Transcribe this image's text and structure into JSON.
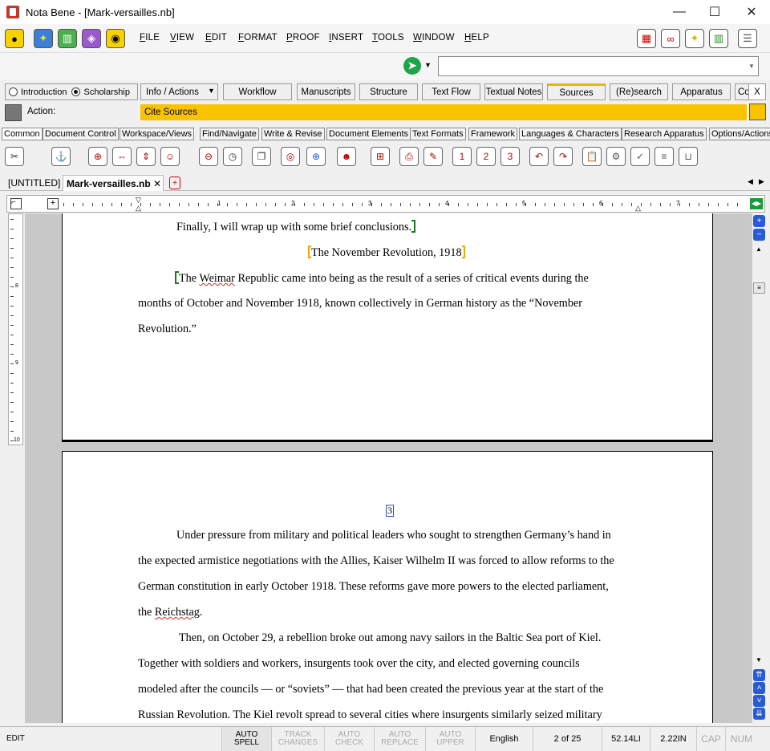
{
  "window": {
    "title": "Nota Bene - [Mark-versailles.nb]",
    "minimize": "—",
    "maximize": "☐",
    "close": "✕"
  },
  "menu": [
    "FILE",
    "VIEW",
    "EDIT",
    "FORMAT",
    "PROOF",
    "INSERT",
    "TOOLS",
    "WINDOW",
    "HELP"
  ],
  "workspace": {
    "radio_introduction": "Introduction",
    "radio_scholarship": "Scholarship",
    "info_actions": "Info / Actions",
    "tabs": [
      "Workflow",
      "Manuscripts",
      "Structure",
      "Text Flow",
      "Textual Notes",
      "Sources",
      "(Re)search",
      "Apparatus",
      "Co"
    ],
    "active_tab": "Sources",
    "close_label": "X"
  },
  "action": {
    "label": "Action:",
    "value": "Cite Sources"
  },
  "toolbar_groups": [
    "Common",
    "Document Control",
    "Workspace/Views",
    "Find/Navigate",
    "Write & Revise",
    "Document Elements",
    "Text Formats",
    "Framework",
    "Languages & Characters",
    "Research Apparatus",
    "Options/Actions"
  ],
  "doc_tabs": {
    "untitled": "[UNTITLED]",
    "current": "Mark-versailles.nb",
    "close": "✕"
  },
  "ruler": {
    "numbers": [
      "1",
      "2",
      "3",
      "4",
      "5",
      "6",
      "7"
    ]
  },
  "vruler": {
    "numbers": [
      "8",
      "9",
      "10"
    ]
  },
  "document": {
    "page1": {
      "l1": "Finally, I will wrap up with some brief conclusions.",
      "heading": "The November Revolution, 1918",
      "p_a1": "The ",
      "p_a2": "Weimar",
      "p_a3": " Republic came into being as the result of a series of critical events during the",
      "p_b": "months of October and November 1918, known collectively in German history as the “November",
      "p_c": "Revolution.”"
    },
    "page2": {
      "page_number": "3",
      "l1": "Under pressure from military and political leaders who sought to strengthen Germany’s hand in",
      "l2": "the expected armistice negotiations with the Allies, Kaiser Wilhelm II was forced to allow reforms to the",
      "l3": "German constitution in early October 1918. These reforms gave more powers to the elected parliament,",
      "l4a": "the ",
      "l4b": "Reichstag",
      "l4c": ".",
      "l5": "Then, on October 29, a rebellion broke out among navy sailors in the Baltic Sea port of Kiel.",
      "l6": "Together with soldiers and workers, insurgents took over the city, and elected governing councils",
      "l7": "modeled after the councils — or “soviets” — that had been created the previous year at the start of the",
      "l8": "Russian Revolution. The Kiel revolt spread to several cities where insurgents similarly seized military"
    }
  },
  "status": {
    "mode": "EDIT",
    "auto_spell": "AUTO SPELL",
    "track_changes": "TRACK CHANGES",
    "auto_check": "AUTO CHECK",
    "auto_replace": "AUTO REPLACE",
    "auto_upper": "AUTO UPPER",
    "language": "English",
    "page": "2 of 25",
    "line": "52.14LI",
    "position": "2.22IN",
    "cap": "CAP",
    "num": "NUM"
  },
  "colors": {
    "action_bar": "#f9c300",
    "active_tab_accent": "#e6b800",
    "nav_blue": "#2a5bd7",
    "tag_green": "#1a7a1a",
    "tag_yellow": "#f0a800"
  }
}
